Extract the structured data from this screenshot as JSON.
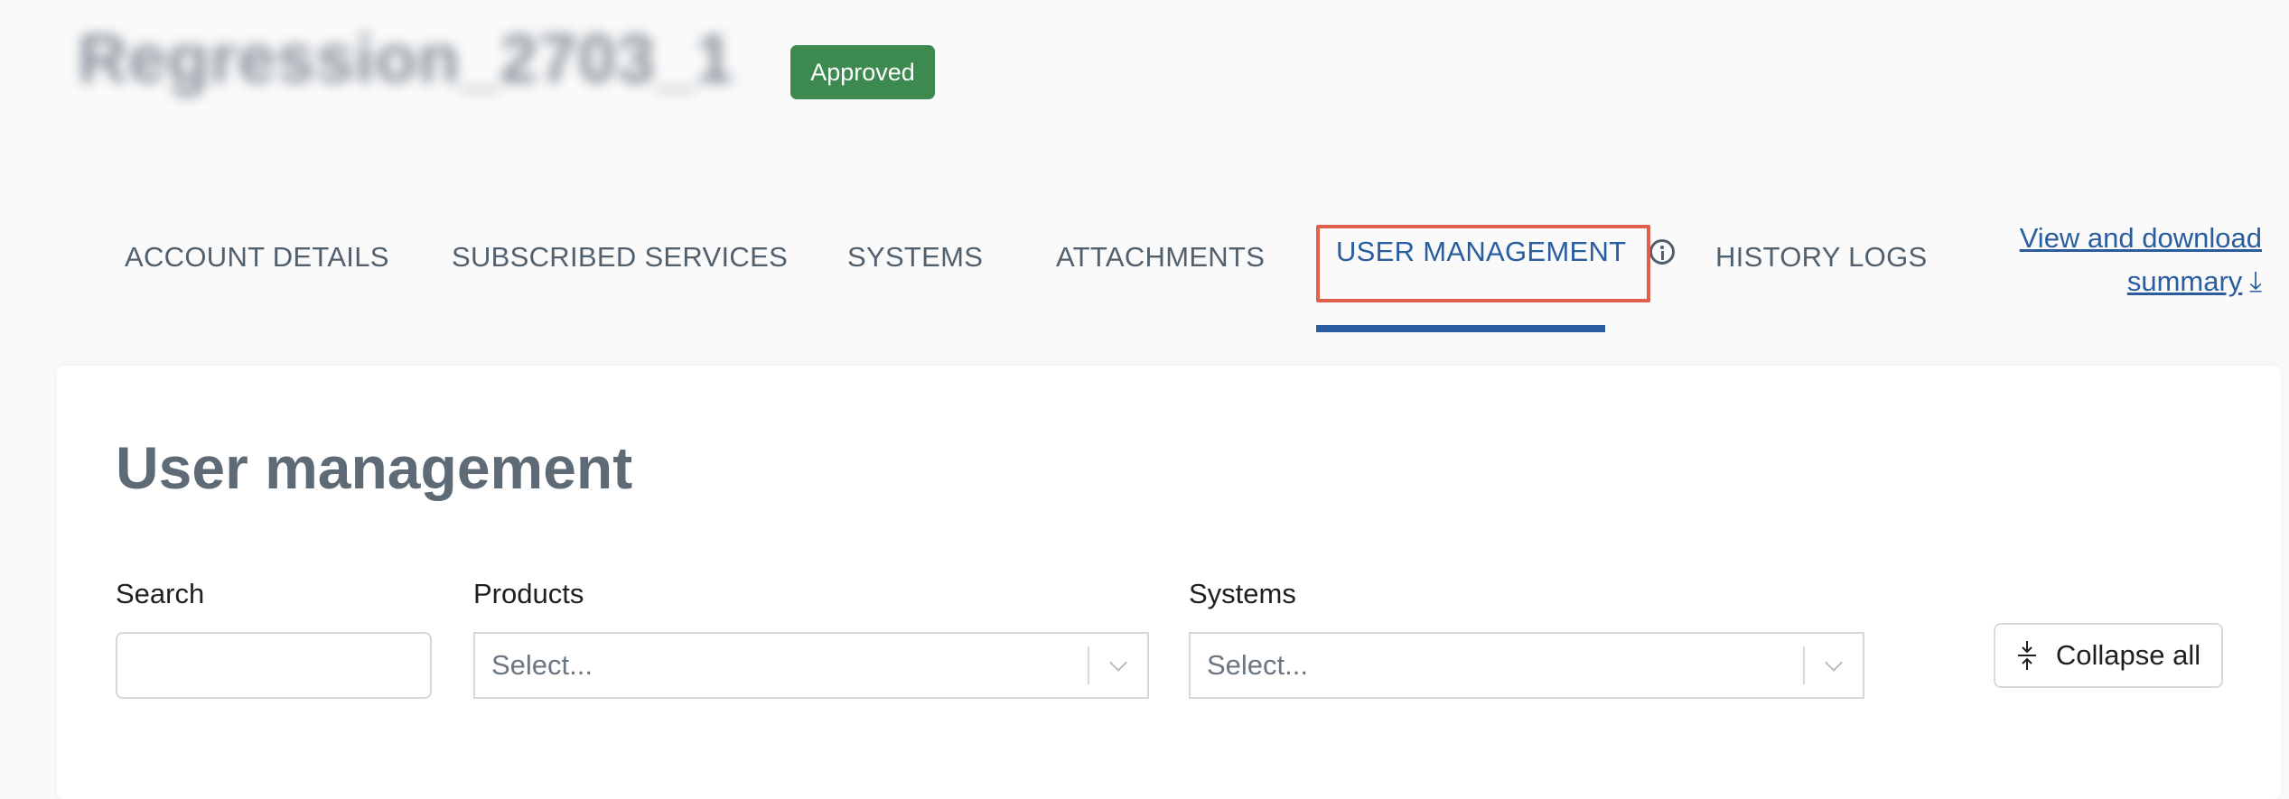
{
  "header": {
    "title": "Regression_2703_1",
    "status": "Approved"
  },
  "tabs": [
    {
      "label": "ACCOUNT DETAILS"
    },
    {
      "label": "SUBSCRIBED SERVICES"
    },
    {
      "label": "SYSTEMS"
    },
    {
      "label": "ATTACHMENTS"
    },
    {
      "label": "USER MANAGEMENT",
      "active": true
    },
    {
      "label": "HISTORY LOGS"
    }
  ],
  "summary_link": {
    "line1": "View and download",
    "line2": "summary"
  },
  "section": {
    "title": "User management"
  },
  "filters": {
    "search_label": "Search",
    "search_value": "",
    "products_label": "Products",
    "products_placeholder": "Select...",
    "systems_label": "Systems",
    "systems_placeholder": "Select..."
  },
  "actions": {
    "collapse_label": "Collapse all"
  },
  "colors": {
    "accent": "#2a5d9f",
    "status_approved": "#3c8a50",
    "highlight": "#e0604c"
  }
}
